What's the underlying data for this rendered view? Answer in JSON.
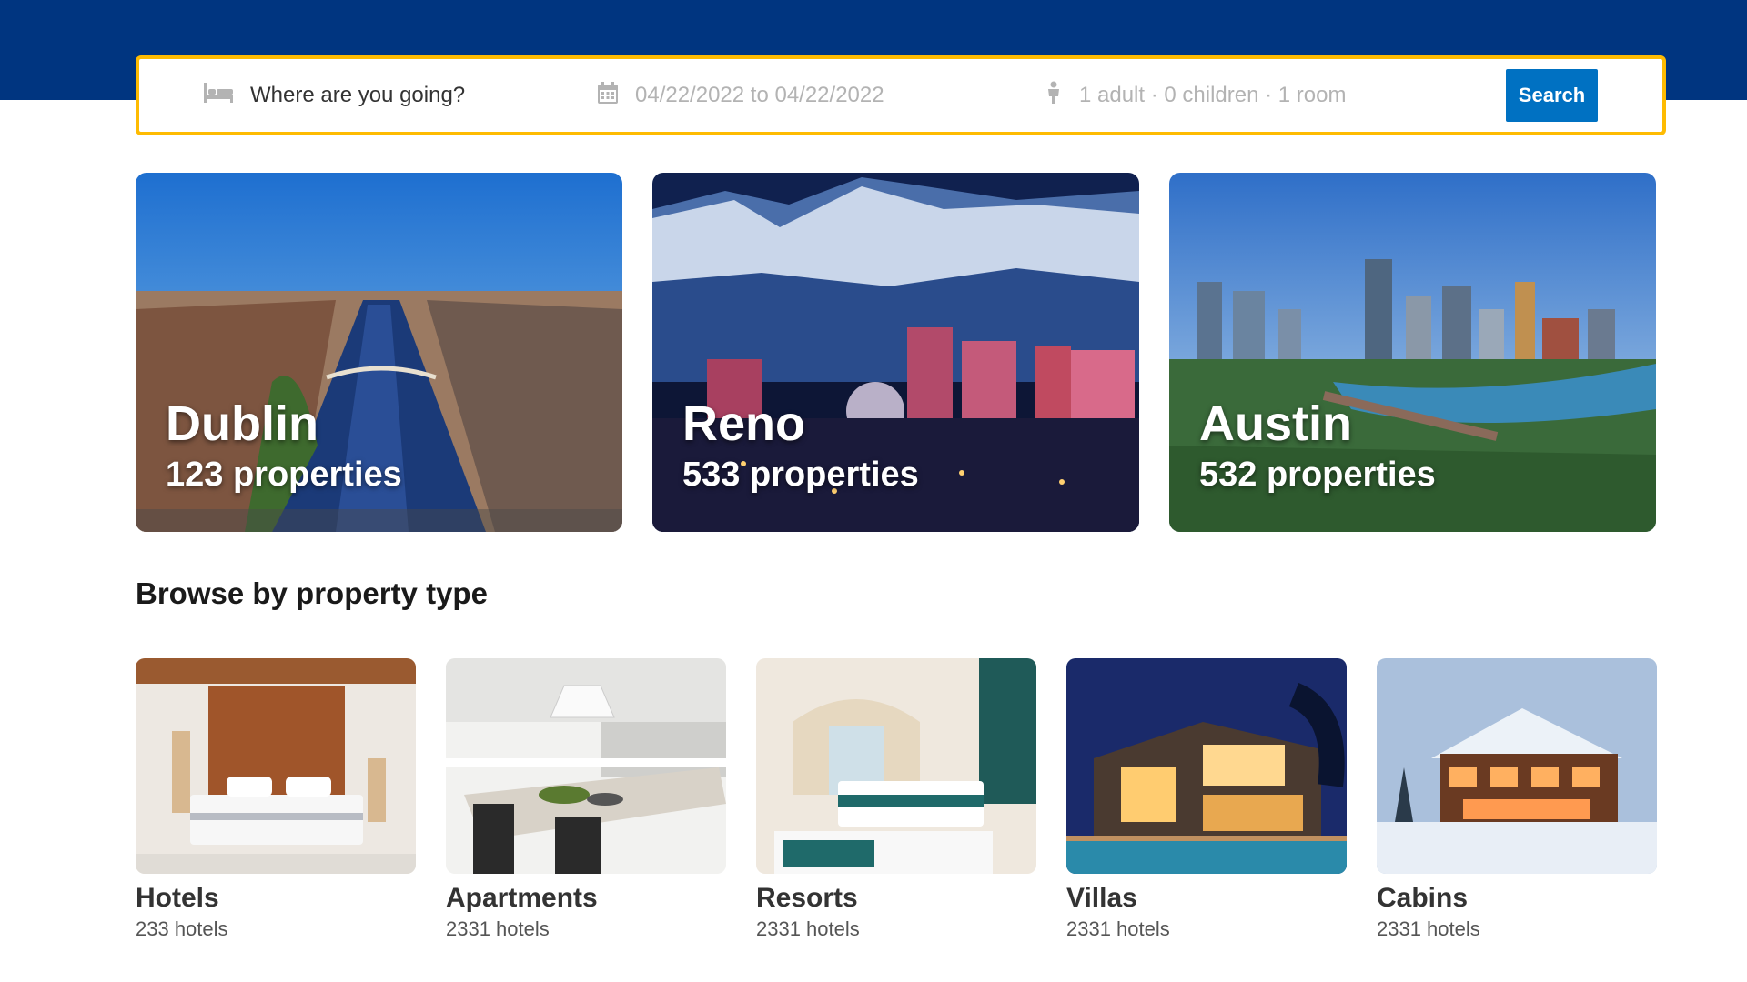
{
  "search": {
    "destination_placeholder": "Where are you going?",
    "dates": "04/22/2022 to 04/22/2022",
    "guests": "1 adult · 0 children · 1 room",
    "button_label": "Search"
  },
  "featured": [
    {
      "name": "Dublin",
      "count": "123 properties"
    },
    {
      "name": "Reno",
      "count": "533 properties"
    },
    {
      "name": "Austin",
      "count": "532 properties"
    }
  ],
  "property_types": {
    "title": "Browse by property type",
    "items": [
      {
        "name": "Hotels",
        "count": "233 hotels"
      },
      {
        "name": "Apartments",
        "count": "2331 hotels"
      },
      {
        "name": "Resorts",
        "count": "2331 hotels"
      },
      {
        "name": "Villas",
        "count": "2331 hotels"
      },
      {
        "name": "Cabins",
        "count": "2331 hotels"
      }
    ]
  },
  "colors": {
    "header_bg": "#003580",
    "search_border": "#febb02",
    "search_button": "#0071c2"
  },
  "icons": [
    "bed-icon",
    "calendar-icon",
    "person-icon"
  ]
}
